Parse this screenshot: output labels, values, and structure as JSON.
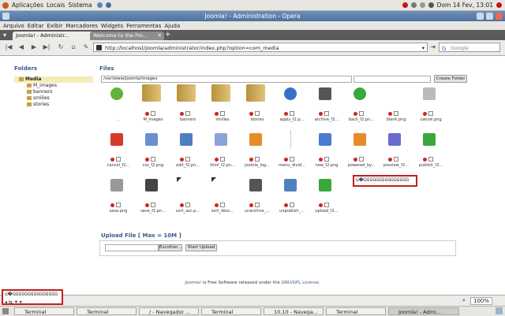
{
  "panel": {
    "menus": [
      "Aplicações",
      "Locais",
      "Sistema"
    ],
    "clock": "Dom 14 Fev, 13:01"
  },
  "window": {
    "title": "Joomla! - Administration - Opera"
  },
  "menubar": {
    "items": [
      "Arquivo",
      "Editar",
      "Exibir",
      "Marcadores",
      "Widgets",
      "Ferramentas",
      "Ajuda"
    ]
  },
  "tabs": [
    {
      "label": "Joomla! - Administr..."
    },
    {
      "label": "Welcome to the Fro..."
    }
  ],
  "nav": {
    "url": "http://localhost/joomla/administrator/index.php?option=com_media",
    "search_placeholder": "Google"
  },
  "folders": {
    "title": "Folders",
    "root": "Media",
    "items": [
      "M_images",
      "banners",
      "smilies",
      "stories"
    ]
  },
  "files": {
    "title": "Files",
    "path": "/var/www/joomla/images",
    "create_folder": "Create Folder",
    "items": [
      {
        "name": "..",
        "icon": "up-arrow-icon"
      },
      {
        "name": "M_images",
        "icon": "folder-icon"
      },
      {
        "name": "banners",
        "icon": "folder-icon"
      },
      {
        "name": "smilies",
        "icon": "folder-icon"
      },
      {
        "name": "stories",
        "icon": "folder-icon"
      },
      {
        "name": "apply_f2.p...",
        "icon": "apply-icon"
      },
      {
        "name": "archive_f2...",
        "icon": "archive-icon"
      },
      {
        "name": "back_f2.pn...",
        "icon": "back-icon"
      },
      {
        "name": "blank.png",
        "icon": "blank-icon"
      },
      {
        "name": "cancel.png",
        "icon": "cancel-gray-icon"
      },
      {
        "name": "cancel_f2...",
        "icon": "cancel-red-icon"
      },
      {
        "name": "css_f2.png",
        "icon": "css-icon"
      },
      {
        "name": "edit_f2.pn...",
        "icon": "edit-icon"
      },
      {
        "name": "html_f2.pn...",
        "icon": "html-icon"
      },
      {
        "name": "joomla_log...",
        "icon": "joomla-logo-icon"
      },
      {
        "name": "menu_divid...",
        "icon": "divider-icon"
      },
      {
        "name": "new_f2.png",
        "icon": "new-icon"
      },
      {
        "name": "powered_by...",
        "icon": "powered-by-icon"
      },
      {
        "name": "preview_f2...",
        "icon": "preview-icon"
      },
      {
        "name": "publish_f2...",
        "icon": "publish-icon"
      },
      {
        "name": "save.png",
        "icon": "save-gray-icon"
      },
      {
        "name": "save_f2.pn...",
        "icon": "save-icon"
      },
      {
        "name": "sort_asc.p...",
        "icon": "sort-asc-icon"
      },
      {
        "name": "sort_desc...",
        "icon": "sort-desc-icon"
      },
      {
        "name": "unarchive_...",
        "icon": "unarchive-icon"
      },
      {
        "name": "unpublish_...",
        "icon": "unpublish-icon"
      },
      {
        "name": "upload_f2...",
        "icon": "upload-icon"
      }
    ]
  },
  "upload": {
    "title": "Upload File [ Max = 10M ]",
    "browse": "Escolher...",
    "start": "Start Upload"
  },
  "footer": {
    "brand": "Joomla!",
    "text": " is Free Software released under the ",
    "license": "GNU/GPL License",
    "end": "."
  },
  "status": {
    "zoom": "100%"
  },
  "overlay": {
    "tooltip_text": "ú�ûûûûûûûûûûûûûûû"
  },
  "taskbar": [
    {
      "label": "Terminal"
    },
    {
      "label": "Terminal"
    },
    {
      "label": "/ - Navegador ..."
    },
    {
      "label": "Terminal"
    },
    {
      "label": "10.10 - Navega..."
    },
    {
      "label": "Terminal"
    },
    {
      "label": "Joomla! - Admi..."
    }
  ],
  "colors": {
    "accent": "#3a5a8c",
    "delete": "#d02525",
    "highlight": "#c51f1f",
    "folder": "#c8a040"
  }
}
